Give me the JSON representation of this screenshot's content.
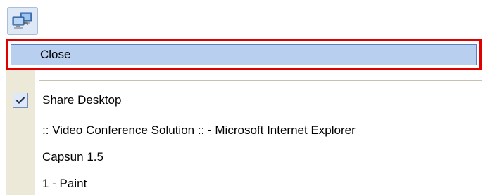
{
  "menu": {
    "icon": "network-computers-icon",
    "items": [
      {
        "label": "Close",
        "highlighted": true
      },
      {
        "label": "Share Desktop",
        "checked": true
      },
      {
        "label": ":: Video Conference Solution :: - Microsoft Internet Explorer",
        "checked": false
      },
      {
        "label": "Capsun 1.5",
        "checked": false
      },
      {
        "label": "1 - Paint",
        "checked": false
      }
    ]
  },
  "colors": {
    "highlight": "#b8cfef",
    "annotation": "#e00000",
    "gutter": "#ece9d8"
  }
}
